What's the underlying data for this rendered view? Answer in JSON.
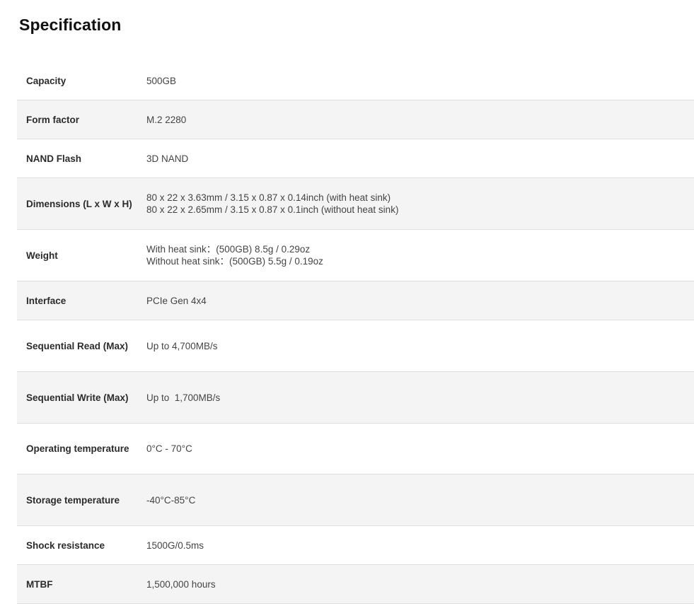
{
  "page": {
    "title": "Specification"
  },
  "specs": [
    {
      "label": "Capacity",
      "lines": [
        "500GB"
      ]
    },
    {
      "label": "Form factor",
      "lines": [
        "M.2 2280"
      ]
    },
    {
      "label": "NAND Flash",
      "lines": [
        "3D NAND"
      ]
    },
    {
      "label": "Dimensions (L x W x H)",
      "lines": [
        "80 x 22 x 3.63mm / 3.15 x 0.87 x 0.14inch (with heat sink)",
        "80 x 22 x 2.65mm / 3.15 x 0.87 x 0.1inch (without heat sink)"
      ]
    },
    {
      "label": "Weight",
      "lines": [
        "With heat sink：(500GB) 8.5g / 0.29oz",
        "Without heat sink：(500GB) 5.5g / 0.19oz"
      ]
    },
    {
      "label": "Interface",
      "lines": [
        "PCIe Gen 4x4"
      ]
    },
    {
      "label": "Sequential Read (Max)",
      "lines": [
        "Up to 4,700MB/s"
      ]
    },
    {
      "label": "Sequential Write (Max)",
      "lines": [
        "Up to  1,700MB/s"
      ]
    },
    {
      "label": "Operating temperature",
      "lines": [
        "0°C - 70°C"
      ]
    },
    {
      "label": "Storage temperature",
      "lines": [
        "-40°C-85°C"
      ]
    },
    {
      "label": "Shock resistance",
      "lines": [
        "1500G/0.5ms"
      ]
    },
    {
      "label": "MTBF",
      "lines": [
        "1,500,000 hours"
      ]
    }
  ]
}
